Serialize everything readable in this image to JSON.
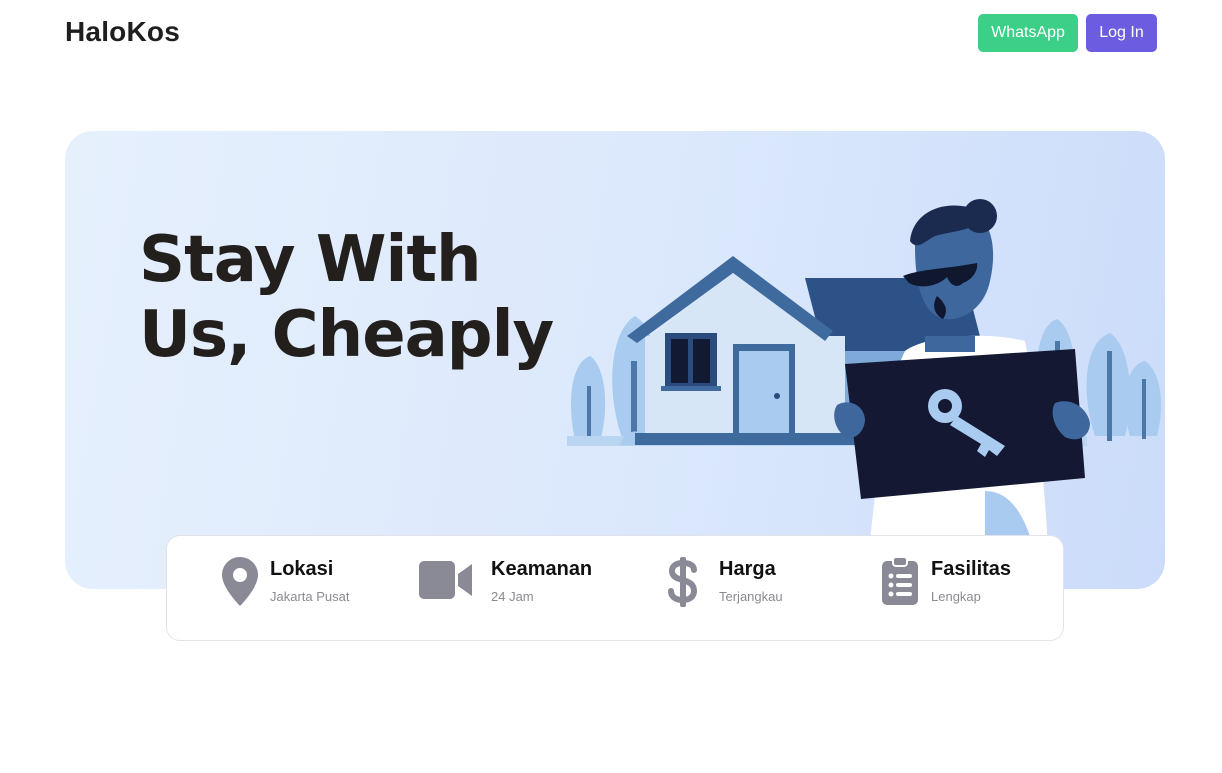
{
  "navbar": {
    "brand": "HaloKos",
    "whatsapp_label": "WhatsApp",
    "login_label": "Log In"
  },
  "hero": {
    "title_line1": "Stay With",
    "title_line2": "Us, Cheaply"
  },
  "features": [
    {
      "title": "Lokasi",
      "subtitle": "Jakarta Pusat",
      "icon": "map-pin-icon"
    },
    {
      "title": "Keamanan",
      "subtitle": "24 Jam",
      "icon": "video-camera-icon"
    },
    {
      "title": "Harga",
      "subtitle": "Terjangkau",
      "icon": "dollar-icon"
    },
    {
      "title": "Fasilitas",
      "subtitle": "Lengkap",
      "icon": "clipboard-list-icon"
    }
  ],
  "colors": {
    "whatsapp": "#3ccf87",
    "login": "#6c5de0",
    "icon_gray": "#8a8a97"
  }
}
